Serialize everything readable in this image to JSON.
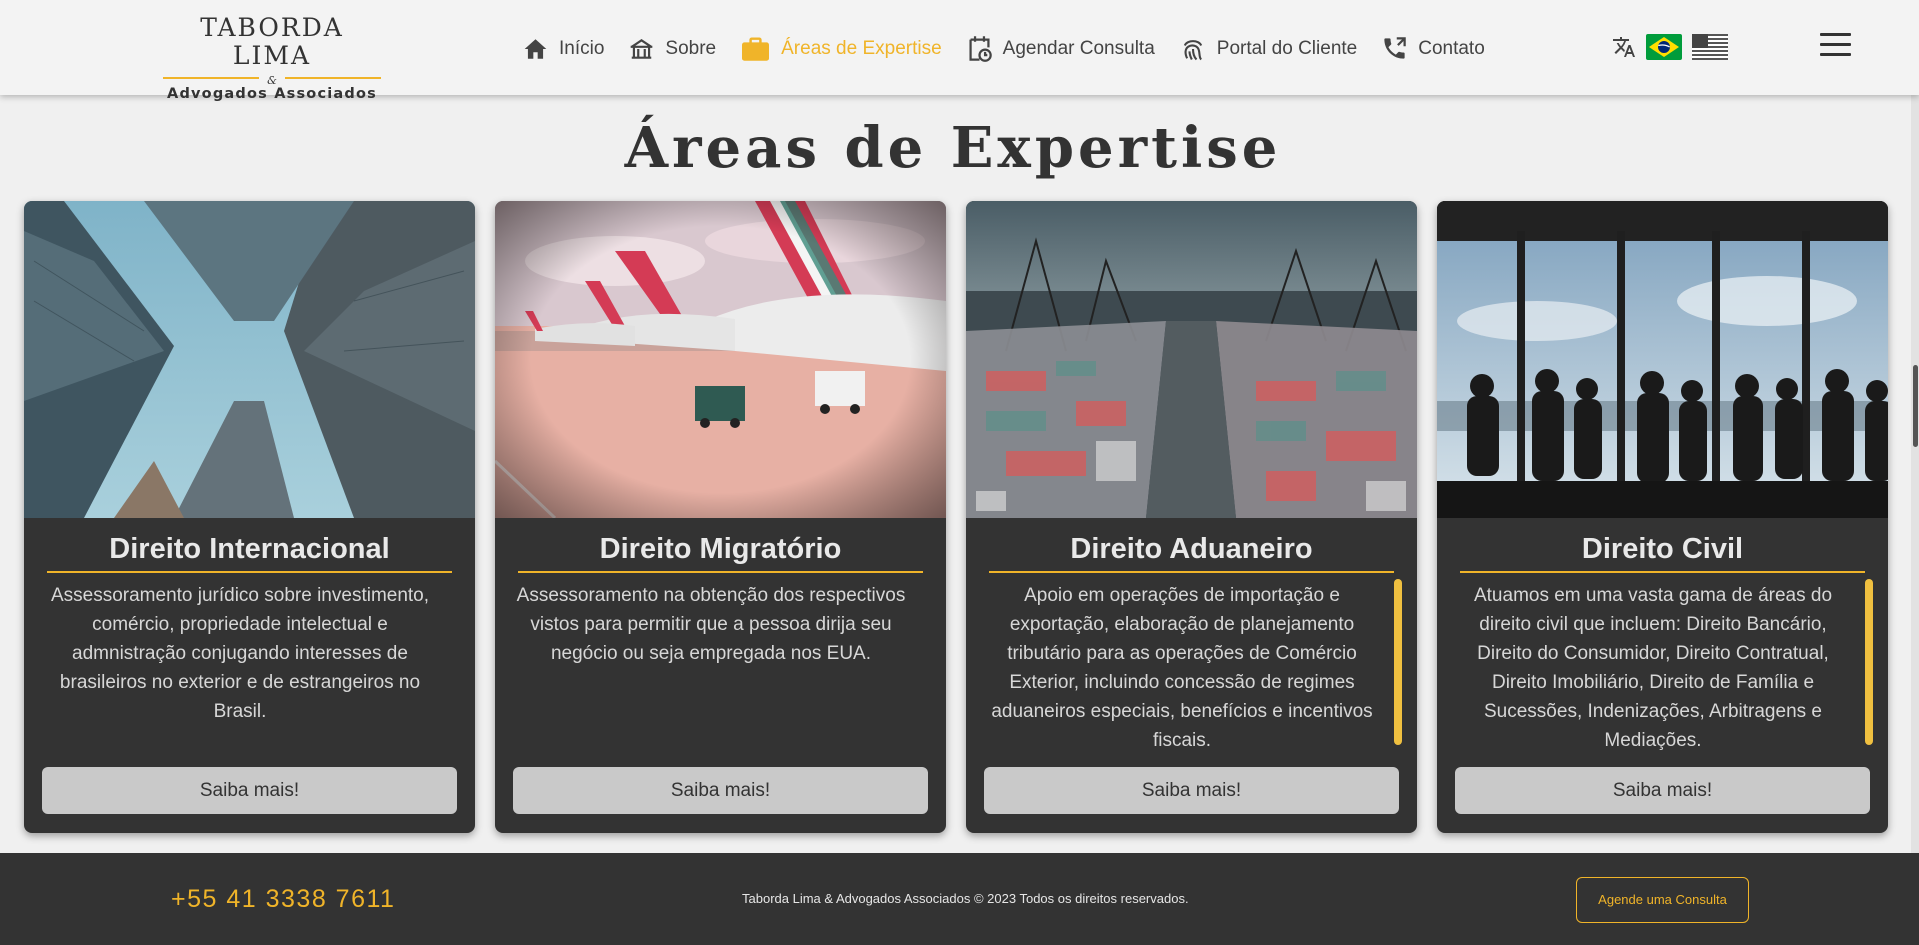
{
  "logo": {
    "name": "TABORDA LIMA",
    "amp": "&",
    "subtitle": "Advogados Associados"
  },
  "nav": [
    {
      "label": "Início",
      "icon": "home-icon"
    },
    {
      "label": "Sobre",
      "icon": "building-icon"
    },
    {
      "label": "Áreas de Expertise",
      "icon": "briefcase-icon",
      "active": true
    },
    {
      "label": "Agendar Consulta",
      "icon": "calendar-clock-icon"
    },
    {
      "label": "Portal do Cliente",
      "icon": "fingerprint-icon"
    },
    {
      "label": "Contato",
      "icon": "phone-icon"
    }
  ],
  "language": {
    "icon": "translate-icon",
    "flags": [
      "brazil-flag",
      "usa-flag"
    ]
  },
  "section_title": "Áreas de Expertise",
  "cards": [
    {
      "title": "Direito Internacional",
      "image": "skyscrapers-from-below",
      "text": "Assessoramento jurídico sobre investimento, comércio, propriedade intelectual e admnistração conjugando interesses de brasileiros no exterior e de estrangeiros no Brasil.",
      "button": "Saiba mais!"
    },
    {
      "title": "Direito Migratório",
      "image": "airplanes-at-airport",
      "text": "Assessoramento na obtenção dos respectivos vistos para permitir que a pessoa dirija seu negócio ou seja empregada nos EUA.",
      "button": "Saiba mais!"
    },
    {
      "title": "Direito Aduaneiro",
      "image": "container-port",
      "text": "Apoio em operações de importação e exportação, elaboração de planejamento tributário para as operações de Comércio Exterior, incluindo concessão de regimes aduaneiros especiais, benefícios e incentivos fiscais.",
      "button": "Saiba mais!"
    },
    {
      "title": "Direito Civil",
      "image": "people-at-window",
      "text": "Atuamos em uma vasta gama de áreas do direito civil que incluem: Direito Bancário, Direito do Consumidor, Direito Contratual, Direito Imobiliário, Direito de Família e Sucessões, Indenizações, Arbitragens e Mediações.",
      "button": "Saiba mais!"
    }
  ],
  "footer": {
    "phone": "+55 41 3338 7611",
    "copyright": "Taborda Lima & Advogados Associados © 2023 Todos os direitos reservados.",
    "cta": "Agende uma Consulta"
  },
  "colors": {
    "accent": "#f0b429",
    "dark": "#333333",
    "background": "#f0f0f0",
    "button": "#c9c9c9"
  }
}
